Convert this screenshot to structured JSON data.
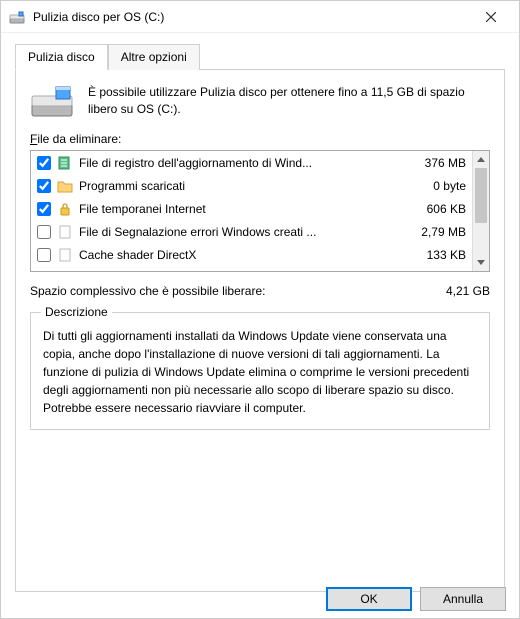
{
  "window": {
    "title": "Pulizia disco per OS (C:)"
  },
  "tabs": {
    "cleanup": "Pulizia disco",
    "more": "Altre opzioni"
  },
  "intro": "È possibile utilizzare Pulizia disco per ottenere fino a 11,5 GB di spazio libero su OS (C:).",
  "list_label": "File da eliminare:",
  "files": [
    {
      "checked": true,
      "icon": "log",
      "name": "File di registro dell'aggiornamento di Wind...",
      "size": "376 MB"
    },
    {
      "checked": true,
      "icon": "folder",
      "name": "Programmi scaricati",
      "size": "0 byte"
    },
    {
      "checked": true,
      "icon": "lock",
      "name": "File temporanei Internet",
      "size": "606 KB"
    },
    {
      "checked": false,
      "icon": "blank",
      "name": "File di Segnalazione errori Windows creati ...",
      "size": "2,79 MB"
    },
    {
      "checked": false,
      "icon": "blank",
      "name": "Cache shader DirectX",
      "size": "133 KB"
    }
  ],
  "total": {
    "label": "Spazio complessivo che è possibile liberare:",
    "value": "4,21 GB"
  },
  "description": {
    "title": "Descrizione",
    "body": "Di tutti gli aggiornamenti installati da Windows Update viene conservata una copia, anche dopo l'installazione di nuove versioni di tali aggiornamenti. La funzione di pulizia di Windows Update elimina o comprime le versioni precedenti degli aggiornamenti non più necessarie allo scopo di liberare spazio su disco. Potrebbe essere necessario riavviare il computer."
  },
  "buttons": {
    "ok": "OK",
    "cancel": "Annulla"
  }
}
